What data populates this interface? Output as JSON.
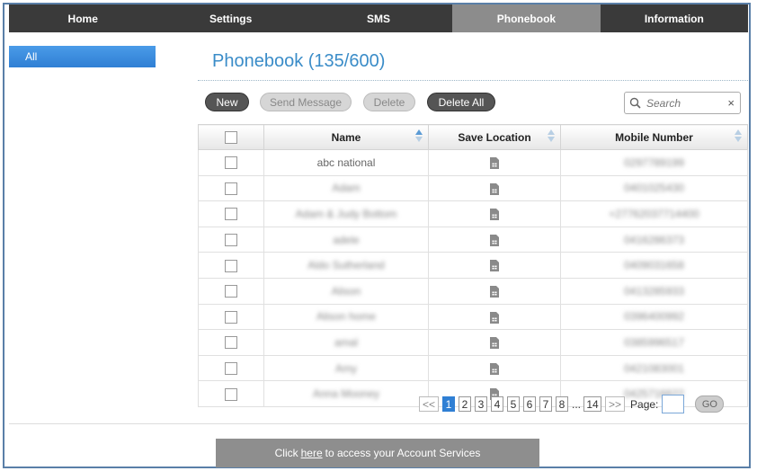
{
  "nav": {
    "tabs": [
      {
        "label": "Home"
      },
      {
        "label": "Settings"
      },
      {
        "label": "SMS"
      },
      {
        "label": "Phonebook"
      },
      {
        "label": "Information"
      }
    ],
    "active_index": 3
  },
  "sidebar": {
    "all_label": "All"
  },
  "main": {
    "title": "Phonebook (135/600)",
    "toolbar": {
      "new_label": "New",
      "send_label": "Send Message",
      "delete_label": "Delete",
      "delete_all_label": "Delete All"
    },
    "search": {
      "placeholder": "Search",
      "clear_glyph": "×"
    },
    "table": {
      "headers": {
        "name": "Name",
        "location": "Save Location",
        "mobile": "Mobile Number"
      },
      "rows": [
        {
          "name": "abc national",
          "mobile": "0297789199"
        },
        {
          "name": "Adam",
          "mobile": "0401025430"
        },
        {
          "name": "Adam & Judy Bottom",
          "mobile": "+27762037714400"
        },
        {
          "name": "adele",
          "mobile": "0416286373"
        },
        {
          "name": "Aldo Sutherland",
          "mobile": "0409031658"
        },
        {
          "name": "Alison",
          "mobile": "0413285933"
        },
        {
          "name": "Alison home",
          "mobile": "0396400992"
        },
        {
          "name": "amal",
          "mobile": "0385996517"
        },
        {
          "name": "Amy",
          "mobile": "0421083001"
        },
        {
          "name": "Anna Mooney",
          "mobile": "0425716622"
        }
      ],
      "blurred_rows": [
        1,
        2,
        3,
        4,
        5,
        6,
        7,
        8,
        9
      ],
      "location_icon": "sim-card-icon"
    },
    "pagination": {
      "prev": "<<",
      "pages": [
        "1",
        "2",
        "3",
        "4",
        "5",
        "6",
        "7",
        "8"
      ],
      "ellipsis": "...",
      "last": "14",
      "next": ">>",
      "current": "1",
      "page_label": "Page:",
      "go_label": "GO"
    }
  },
  "footer": {
    "prefix": "Click",
    "link": "here",
    "suffix": "to access your Account Services"
  }
}
